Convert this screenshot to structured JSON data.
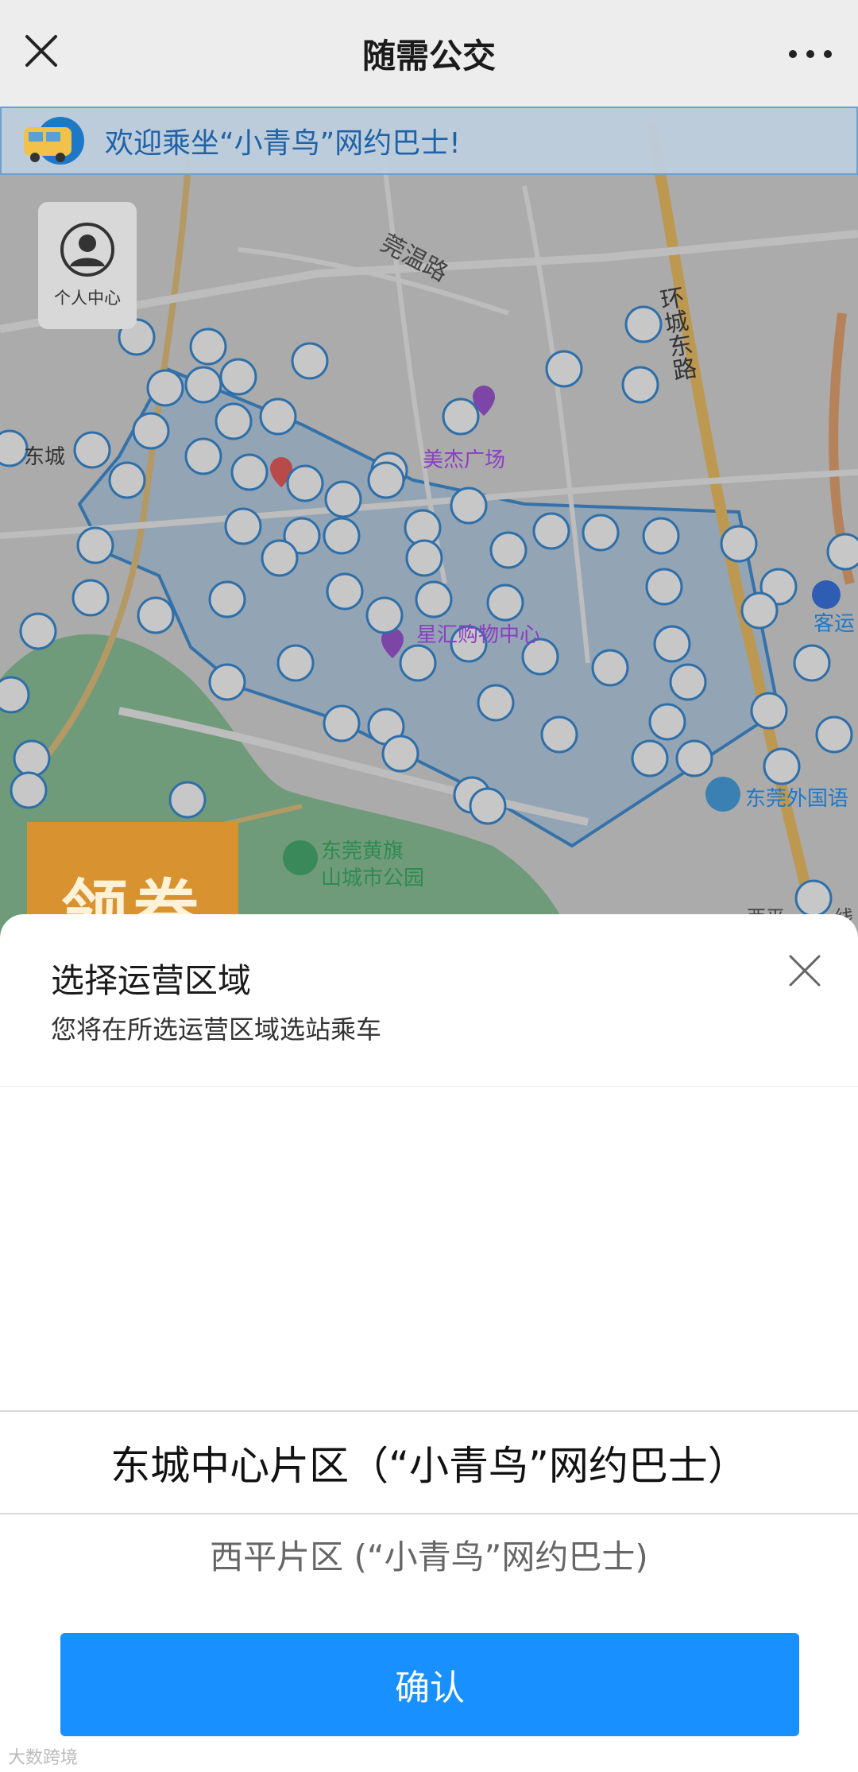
{
  "header": {
    "title": "随需公交",
    "close_icon": "close-icon",
    "more_icon": "more-icon"
  },
  "map": {
    "banner_text": "欢迎乘坐“小青鸟”网约巴士!",
    "user_center_label": "个人中心",
    "coupon_label": "领券",
    "labels": {
      "road_wanwen": "莞温路",
      "road_huancheng_east": "环城东路",
      "meijie_plaza": "美杰广场",
      "xingjiang_mall": "星汇购物中心",
      "dongcheng_left": "东城",
      "dongguan_foreign_school": "东莞外国语",
      "huangqi_park_1": "东莞黄旗",
      "huangqi_park_2": "山城市公园",
      "keyun": "客运",
      "xiping_bottom": "西平",
      "xian": "线"
    },
    "colors": {
      "zone_fill": "#a9c1d8",
      "zone_border": "#1e78c8",
      "park": "#78b487",
      "road_major": "#e3b04d"
    }
  },
  "sheet": {
    "title": "选择运营区域",
    "subtitle": "您将在所选运营区域选站乘车",
    "options": [
      {
        "label": "东城中心片区（“小青鸟”网约巴士）",
        "selected": true
      },
      {
        "label": "西平片区 (“小青鸟”网约巴士)",
        "selected": false
      }
    ],
    "confirm_label": "确认",
    "accent": "#1890ff"
  },
  "watermark": "大数跨境"
}
